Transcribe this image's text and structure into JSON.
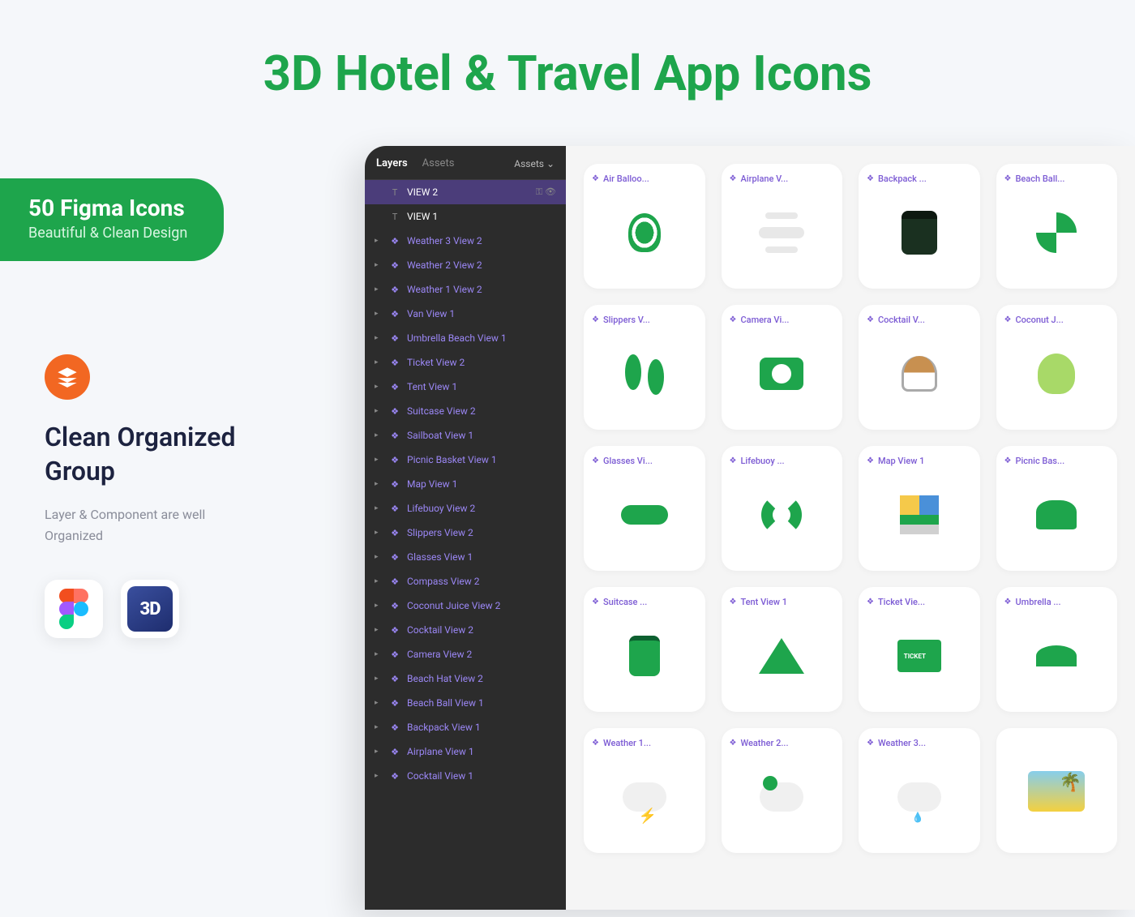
{
  "title": "3D Hotel & Travel App Icons",
  "badge": {
    "heading": "50 Figma Icons",
    "sub": "Beautiful & Clean Design"
  },
  "feature": {
    "heading_l1": "Clean Organized",
    "heading_l2": "Group",
    "desc_l1": "Layer & Component are well",
    "desc_l2": "Organized"
  },
  "logos": {
    "cube_text": "3D"
  },
  "sidebar": {
    "tab_layers": "Layers",
    "tab_assets": "Assets",
    "dropdown": "Assets",
    "layers": [
      {
        "type": "text",
        "label": "VIEW 2",
        "selected": true,
        "lock": true
      },
      {
        "type": "text",
        "label": "VIEW 1"
      },
      {
        "type": "comp",
        "label": "Weather 3 View 2"
      },
      {
        "type": "comp",
        "label": "Weather 2 View 2"
      },
      {
        "type": "comp",
        "label": "Weather 1 View 2"
      },
      {
        "type": "comp",
        "label": "Van View 1"
      },
      {
        "type": "comp",
        "label": "Umbrella Beach View 1"
      },
      {
        "type": "comp",
        "label": "Ticket View 2"
      },
      {
        "type": "comp",
        "label": "Tent View 1"
      },
      {
        "type": "comp",
        "label": "Suitcase View 2"
      },
      {
        "type": "comp",
        "label": "Sailboat View 1"
      },
      {
        "type": "comp",
        "label": "Picnic Basket View 1"
      },
      {
        "type": "comp",
        "label": "Map View 1"
      },
      {
        "type": "comp",
        "label": "Lifebuoy View 2"
      },
      {
        "type": "comp",
        "label": "Slippers View 2"
      },
      {
        "type": "comp",
        "label": "Glasses View 1"
      },
      {
        "type": "comp",
        "label": "Compass View 2"
      },
      {
        "type": "comp",
        "label": "Coconut Juice View 2"
      },
      {
        "type": "comp",
        "label": "Cocktail View 2"
      },
      {
        "type": "comp",
        "label": "Camera View 2"
      },
      {
        "type": "comp",
        "label": "Beach Hat View 2"
      },
      {
        "type": "comp",
        "label": "Beach Ball View 1"
      },
      {
        "type": "comp",
        "label": "Backpack View 1"
      },
      {
        "type": "comp",
        "label": "Airplane View 1"
      },
      {
        "type": "comp",
        "label": "Cocktail View 1"
      }
    ]
  },
  "cards": [
    {
      "label": "Air Balloo...",
      "icon": "i-balloon"
    },
    {
      "label": "Airplane V...",
      "icon": "i-plane"
    },
    {
      "label": "Backpack ...",
      "icon": "i-pack"
    },
    {
      "label": "Beach Ball...",
      "icon": "i-ball"
    },
    {
      "label": "Slippers V...",
      "icon": "i-slip"
    },
    {
      "label": "Camera Vi...",
      "icon": "i-cam"
    },
    {
      "label": "Cocktail V...",
      "icon": "i-cock"
    },
    {
      "label": "Coconut J...",
      "icon": "i-coco"
    },
    {
      "label": "Glasses Vi...",
      "icon": "i-glass"
    },
    {
      "label": "Lifebuoy ...",
      "icon": "i-life"
    },
    {
      "label": "Map View 1",
      "icon": "i-map"
    },
    {
      "label": "Picnic Bas...",
      "icon": "i-picnic"
    },
    {
      "label": "Suitcase ...",
      "icon": "i-suit"
    },
    {
      "label": "Tent View 1",
      "icon": "i-tent"
    },
    {
      "label": "Ticket Vie...",
      "icon": "i-tick"
    },
    {
      "label": "Umbrella ...",
      "icon": "i-umb"
    },
    {
      "label": "Weather 1...",
      "icon": "i-w1"
    },
    {
      "label": "Weather 2...",
      "icon": "i-w2"
    },
    {
      "label": "Weather 3...",
      "icon": "i-w3"
    },
    {
      "label": "",
      "icon": "i-promo"
    }
  ]
}
